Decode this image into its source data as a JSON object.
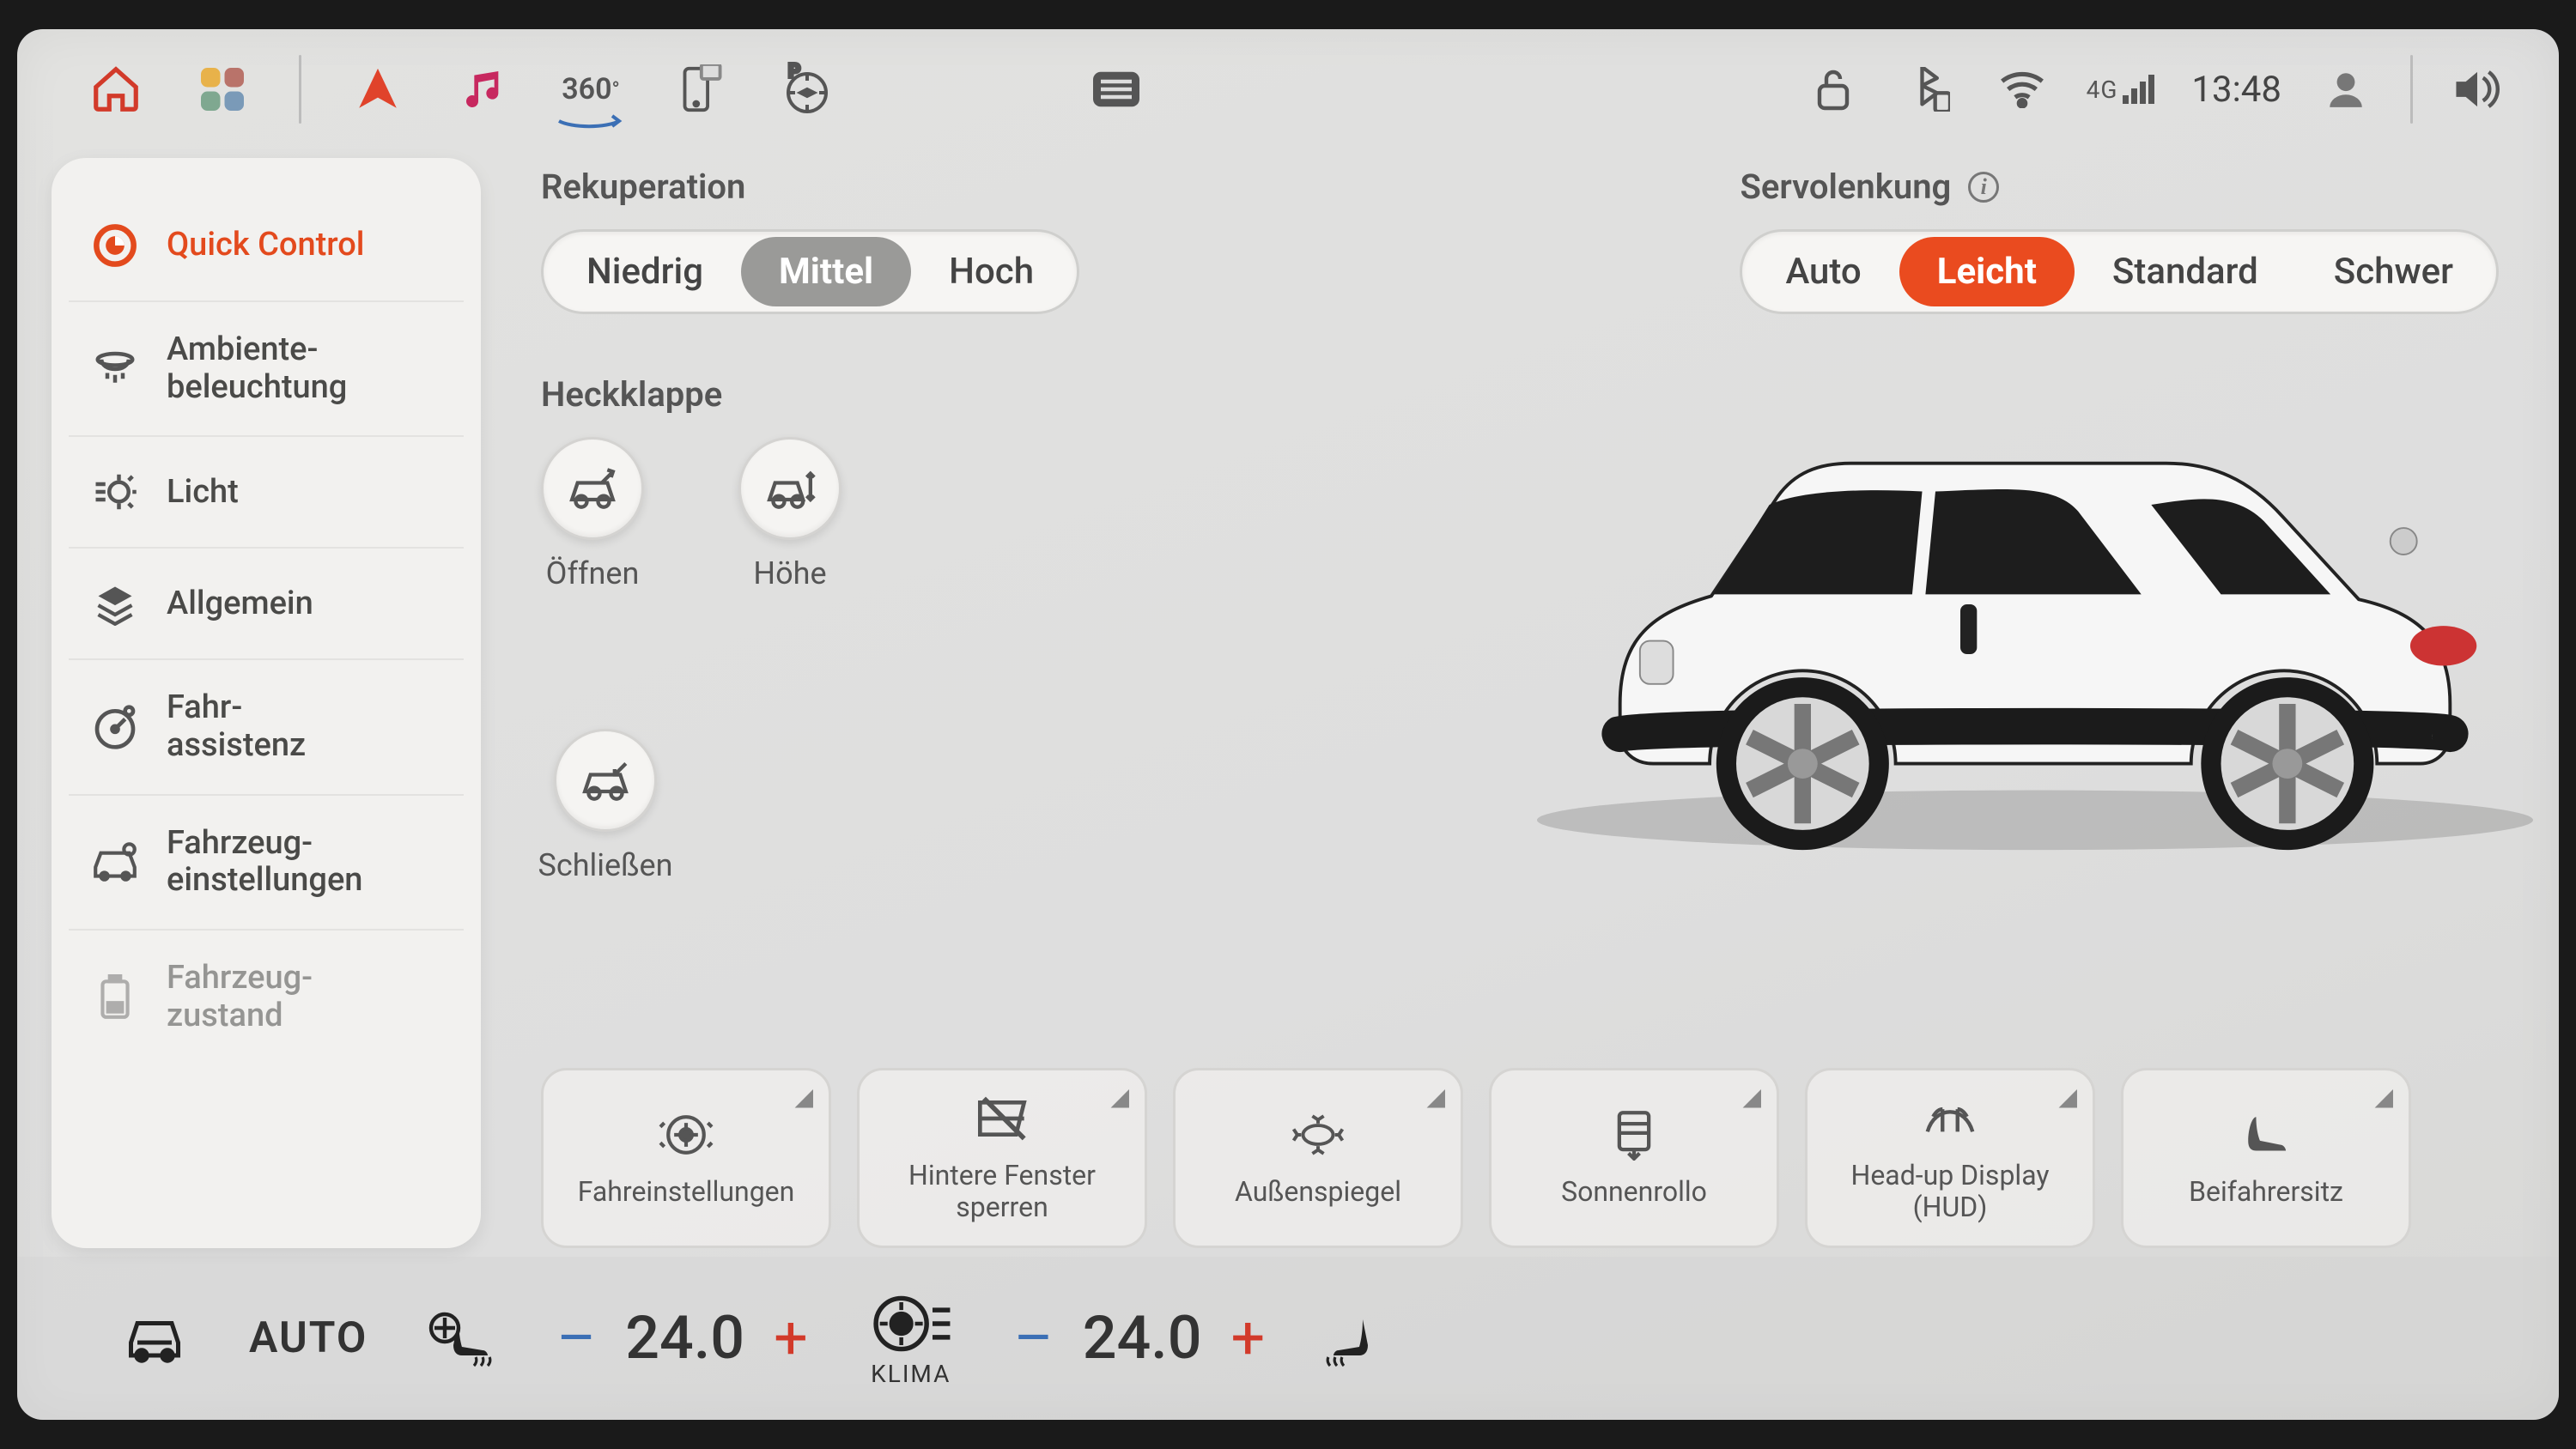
{
  "status": {
    "network": "4G",
    "time": "13:48"
  },
  "sidebar": {
    "items": [
      {
        "label": "Quick Control"
      },
      {
        "label": "Ambiente-\nbeleuchtung"
      },
      {
        "label": "Licht"
      },
      {
        "label": "Allgemein"
      },
      {
        "label": "Fahr-\nassistenz"
      },
      {
        "label": "Fahrzeug-\neinstellungen"
      },
      {
        "label": "Fahrzeug-\nzustand"
      }
    ],
    "active": 0
  },
  "rekuperation": {
    "title": "Rekuperation",
    "options": [
      "Niedrig",
      "Mittel",
      "Hoch"
    ],
    "selected": 1
  },
  "servolenkung": {
    "title": "Servolenkung",
    "options": [
      "Auto",
      "Leicht",
      "Standard",
      "Schwer"
    ],
    "selected": 1
  },
  "heckklappe": {
    "title": "Heckklappe",
    "buttons": [
      "Öffnen",
      "Höhe",
      "Schließen"
    ]
  },
  "tiles": [
    "Fahreinstellungen",
    "Hintere Fenster sperren",
    "Außenspiegel",
    "Sonnenrollo",
    "Head-up Display (HUD)",
    "Beifahrersitz"
  ],
  "climate": {
    "auto": "AUTO",
    "left_temp": "24.0",
    "right_temp": "24.0",
    "klima_label": "KLIMA",
    "minus": "–",
    "plus": "+"
  },
  "colors": {
    "accent": "#ea4b1f"
  }
}
